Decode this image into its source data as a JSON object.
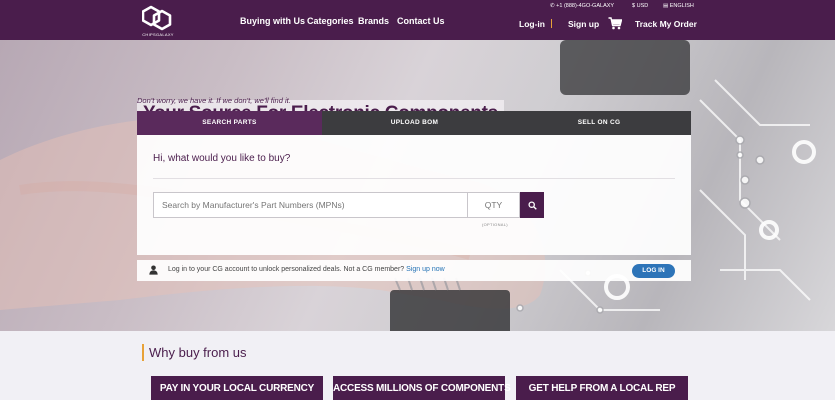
{
  "brand": {
    "logo_text": "CHIPSGALAXY"
  },
  "nav": {
    "items": [
      "Buying with Us",
      "Categories",
      "Brands",
      "Contact Us"
    ]
  },
  "topbar": {
    "phone": "+1 (888)-4GO-GALAXY",
    "currency": "USD",
    "language": "ENGLISH"
  },
  "utility": {
    "login": "Log-in",
    "signup": "Sign up",
    "track": "Track My Order"
  },
  "hero": {
    "title": "Your Source For Electronic Components",
    "subtitle": "Don't worry, we have it. If we don't, we'll find it."
  },
  "tabs": [
    {
      "label": "SEARCH PARTS",
      "active": true
    },
    {
      "label": "UPLOAD BOM",
      "active": false
    },
    {
      "label": "SELL ON CG",
      "active": false
    }
  ],
  "search": {
    "prompt": "Hi, what would you like to buy?",
    "placeholder": "Search by Manufacturer's Part Numbers (MPNs)",
    "qty_placeholder": "QTY",
    "qty_note": "(OPTIONAL)"
  },
  "login_bar": {
    "text": "Log in to your CG account to unlock personalized deals. Not a CG member?",
    "signup_link": "Sign up now",
    "button": "LOG IN"
  },
  "why": {
    "title": "Why buy from us",
    "buttons": [
      "PAY IN YOUR LOCAL CURRENCY",
      "ACCESS MILLIONS OF COMPONENTS",
      "GET HELP FROM A LOCAL REP"
    ]
  },
  "colors": {
    "primary": "#4a1d4c",
    "accent": "#e8a238",
    "link": "#2573b5",
    "button_blue": "#2d74b8"
  },
  "icons": [
    "logo-icon",
    "phone-icon",
    "currency-icon",
    "language-icon",
    "cart-icon",
    "search-icon",
    "user-icon"
  ]
}
